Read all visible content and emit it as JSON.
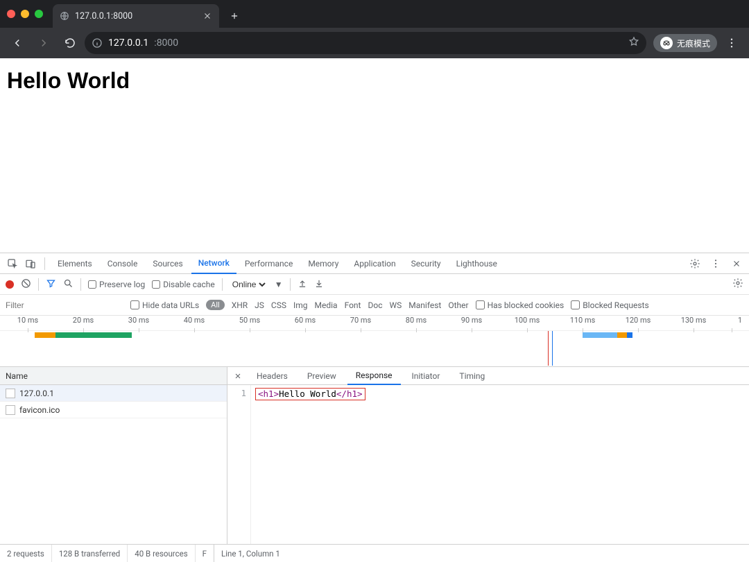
{
  "browser": {
    "tab_title": "127.0.0.1:8000",
    "url_host": "127.0.0.1",
    "url_port": ":8000",
    "incognito_label": "无痕模式"
  },
  "page": {
    "heading": "Hello World"
  },
  "devtools": {
    "tabs": [
      "Elements",
      "Console",
      "Sources",
      "Network",
      "Performance",
      "Memory",
      "Application",
      "Security",
      "Lighthouse"
    ],
    "active_tab": "Network",
    "toolbar": {
      "preserve_log": "Preserve log",
      "disable_cache": "Disable cache",
      "throttle": "Online"
    },
    "filter": {
      "placeholder": "Filter",
      "hide_data_urls": "Hide data URLs",
      "all_pill": "All",
      "types": [
        "XHR",
        "JS",
        "CSS",
        "Img",
        "Media",
        "Font",
        "Doc",
        "WS",
        "Manifest",
        "Other"
      ],
      "has_blocked_cookies": "Has blocked cookies",
      "blocked_requests": "Blocked Requests"
    },
    "timeline_ticks": [
      "10 ms",
      "20 ms",
      "30 ms",
      "40 ms",
      "50 ms",
      "60 ms",
      "70 ms",
      "80 ms",
      "90 ms",
      "100 ms",
      "110 ms",
      "120 ms",
      "130 ms",
      "1"
    ],
    "requests": {
      "header": "Name",
      "items": [
        "127.0.0.1",
        "favicon.ico"
      ]
    },
    "detail": {
      "tabs": [
        "Headers",
        "Preview",
        "Response",
        "Initiator",
        "Timing"
      ],
      "active": "Response",
      "line_no": "1",
      "code_open": "<h1>",
      "code_text": "Hello World",
      "code_close": "</h1>"
    },
    "status": {
      "requests": "2 requests",
      "transferred": "128 B transferred",
      "resources": "40 B resources",
      "f": "F",
      "cursor": "Line 1, Column 1"
    }
  }
}
